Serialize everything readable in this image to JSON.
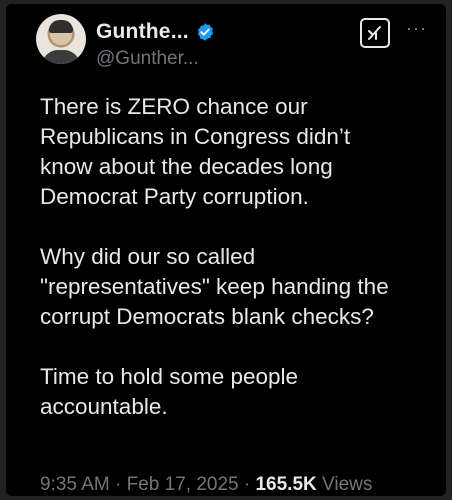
{
  "tweet": {
    "author": {
      "display_name": "Gunthe...",
      "handle": "@Gunther...",
      "avatar_icon": "user-avatar",
      "verified_icon": "verified-badge-icon"
    },
    "body": [
      "There is ZERO chance our\nRepublicans in Congress didn’t\nknow about the decades long\nDemocrat Party corruption.",
      "Why did our so called\n\"representatives\" keep handing the\ncorrupt Democrats blank checks?",
      "Time to hold some people\naccountable."
    ],
    "time": "9:35 AM",
    "sep1": "·",
    "date": "Feb 17, 2025",
    "sep2": "·",
    "views_count": "165.5K",
    "views_label": "Views",
    "more_label": "···"
  },
  "colors": {
    "background": "#000000",
    "text_primary": "#e7e9ea",
    "text_secondary": "#71767b",
    "verified_blue": "#1d9bf0"
  }
}
